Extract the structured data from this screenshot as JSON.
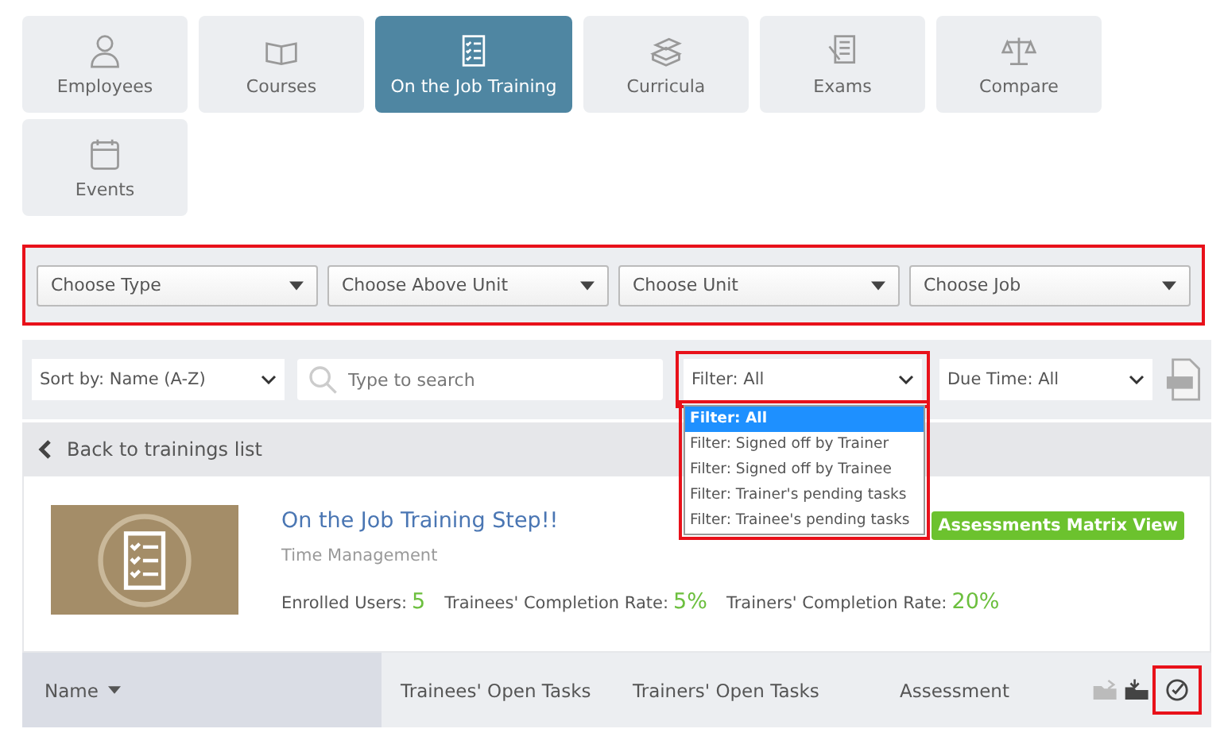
{
  "tabs": [
    {
      "label": "Employees",
      "selected": false
    },
    {
      "label": "Courses",
      "selected": false
    },
    {
      "label": "On the Job Training",
      "selected": true
    },
    {
      "label": "Curricula",
      "selected": false
    },
    {
      "label": "Exams",
      "selected": false
    },
    {
      "label": "Compare",
      "selected": false
    },
    {
      "label": "Events",
      "selected": false
    }
  ],
  "unit_filters": {
    "highlighted": true,
    "selects": [
      "Choose Type",
      "Choose Above Unit",
      "Choose Unit",
      "Choose Job"
    ]
  },
  "toolbar": {
    "sort": "Sort by: Name (A-Z)",
    "search": {
      "placeholder": "Type to search"
    },
    "filter": {
      "value": "Filter: All",
      "highlighted": true,
      "options": [
        {
          "label": "Filter: All",
          "selected": true
        },
        {
          "label": "Filter: Signed off by Trainer",
          "selected": false
        },
        {
          "label": "Filter: Signed off by Trainee",
          "selected": false
        },
        {
          "label": "Filter: Trainer's pending tasks",
          "selected": false
        },
        {
          "label": "Filter: Trainee's pending tasks",
          "selected": false
        }
      ]
    },
    "due_time": "Due Time: All"
  },
  "back_link": "Back to trainings list",
  "training": {
    "title": "On the Job Training Step!!",
    "subtitle": "Time Management",
    "button": "Assessments Matrix View",
    "stats": [
      {
        "label": "Enrolled Users:",
        "value": "5"
      },
      {
        "label": "Trainees' Completion Rate:",
        "value": "5%"
      },
      {
        "label": "Trainers' Completion Rate:",
        "value": "20%"
      }
    ]
  },
  "table": {
    "columns": [
      "Name",
      "Trainees' Open Tasks",
      "Trainers' Open Tasks",
      "Assessment"
    ],
    "check_icon_highlighted": true
  }
}
